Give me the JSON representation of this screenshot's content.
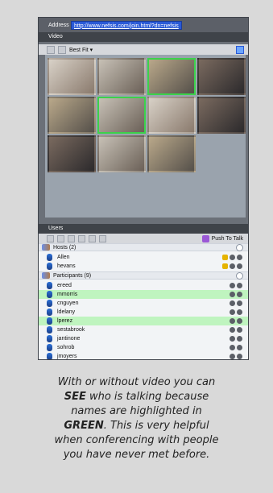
{
  "app": {
    "address_label": "Address",
    "address_url": "http://www.nefsis.com/join.html?dn=nefsis",
    "video_label": "Video",
    "bestfit_label": "Best Fit ▾",
    "users_label": "Users",
    "push_to_talk_label": "Push To Talk",
    "colors": {
      "highlight_green": "#bff4bf",
      "active_video_border": "#3cd24b",
      "address_bar_bg": "#2a5ad7"
    }
  },
  "groups": {
    "hosts": {
      "label": "Hosts (2)",
      "members": [
        {
          "name": "Allen",
          "highlight": false
        },
        {
          "name": "hevans",
          "highlight": false
        }
      ]
    },
    "participants": {
      "label": "Participants (9)",
      "members": [
        {
          "name": "ereed",
          "highlight": false
        },
        {
          "name": "mmorris",
          "highlight": true
        },
        {
          "name": "cnguyen",
          "highlight": false
        },
        {
          "name": "ldelany",
          "highlight": false
        },
        {
          "name": "lperez",
          "highlight": true
        },
        {
          "name": "sestabrook",
          "highlight": false
        },
        {
          "name": "jantinone",
          "highlight": false
        },
        {
          "name": "sohrob",
          "highlight": false
        },
        {
          "name": "jmoyers",
          "highlight": false
        }
      ]
    }
  },
  "caption": {
    "line1": "With or without video you can",
    "see": "SEE",
    "line2_rest": " who is talking because",
    "line3": "names are highlighted in",
    "green": "GREEN",
    "line4_rest": ". This is very helpful",
    "line5": "when conferencing with people",
    "line6": "you have never met before."
  },
  "icons": {
    "toolbar_left": "layout-icon",
    "toolbar_grid": "grid-icon",
    "toolbar_right": "window-icon",
    "users_group": "people-icon",
    "user_person": "user-icon",
    "host_key": "key-icon",
    "status_dot": "status-icon",
    "push_to_talk": "microphone-icon"
  }
}
